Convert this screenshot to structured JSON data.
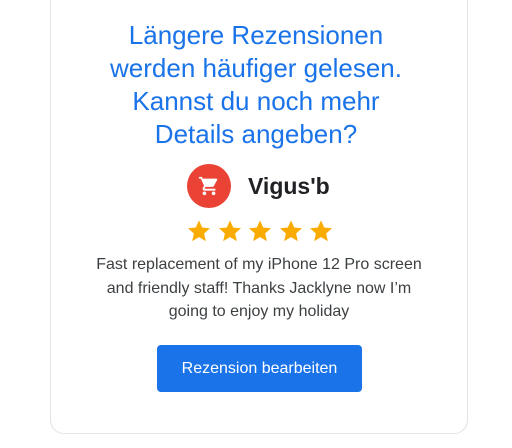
{
  "prompt": {
    "lines": [
      "Längere Rezensionen",
      "werden häufiger gelesen.",
      "Kannst du noch mehr",
      "Details angeben?"
    ]
  },
  "business": {
    "name": "Vigus'b",
    "icon": "shopping-cart-icon",
    "icon_bg": "#ea4335"
  },
  "rating": {
    "stars": 5,
    "max": 5,
    "color": "#f9ab00"
  },
  "review": {
    "lines": [
      "Fast replacement of my iPhone 12 Pro screen",
      "and friendly staff! Thanks Jacklyne now I’m",
      "going to enjoy my holiday"
    ]
  },
  "edit_button": {
    "label": "Rezension bearbeiten"
  },
  "colors": {
    "accent": "#1a73e8",
    "text": "#202124"
  }
}
